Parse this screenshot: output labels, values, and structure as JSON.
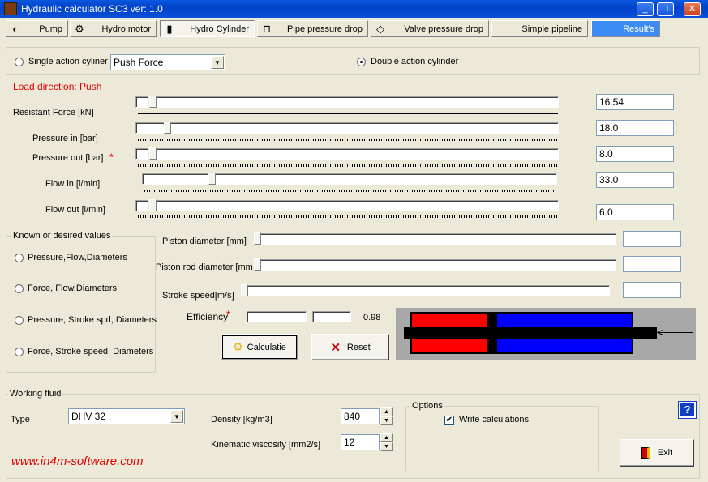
{
  "window": {
    "title": "Hydraulic calculator SC3  ver: 1.0",
    "min": "_",
    "max": "□",
    "close": "✕"
  },
  "toolbar": [
    {
      "label": "Pump",
      "icon": "◐"
    },
    {
      "label": "Hydro motor",
      "icon": "⚙"
    },
    {
      "label": "Hydro Cylinder",
      "icon": "▮"
    },
    {
      "label": "Pipe pressure drop",
      "icon": "⊓"
    },
    {
      "label": "Valve pressure drop",
      "icon": "◇"
    },
    {
      "label": "Simple pipeline",
      "icon": ""
    },
    {
      "label": "Result's",
      "icon": ""
    }
  ],
  "cylinder_type": {
    "single_label": "Single action cyliner",
    "force_select": "Push Force",
    "double_label": "Double action cylinder"
  },
  "load_direction": "Load direction: Push",
  "params": {
    "resistant_force": {
      "label": "Resistant Force [kN]",
      "value": "16.54"
    },
    "pressure_in": {
      "label": "Pressure in [bar]",
      "value": "18.0"
    },
    "pressure_out": {
      "label": "Pressure out [bar]",
      "star": "*",
      "value": "8.0"
    },
    "flow_in": {
      "label": "Flow in [l/min]",
      "value": "33.0"
    },
    "flow_out": {
      "label": "Flow out [l/min]",
      "value": "6.0"
    }
  },
  "known_values": {
    "title": "Known or desired values",
    "options": [
      "Pressure,Flow,Diameters",
      "Force, Flow,Diameters",
      "Pressure, Stroke spd, Diameters",
      "Force, Stroke speed, Diameters"
    ]
  },
  "geometry": {
    "piston_diameter": "Piston diameter [mm]",
    "rod_diameter": "Piston rod diameter [mm",
    "stroke_speed": "Stroke speed[m/s]",
    "efficiency_label": "Efficiency",
    "efficiency_star": "*",
    "efficiency_value": "0.98"
  },
  "actions": {
    "calculate": "Calculatie",
    "reset": "Reset"
  },
  "working_fluid": {
    "title": "Working fluid",
    "type_label": "Type",
    "type_value": "DHV 32",
    "density_label": "Density [kg/m3]",
    "density_value": "840",
    "viscosity_label": "Kinematic viscosity [mm2/s]",
    "viscosity_value": "12"
  },
  "options": {
    "title": "Options",
    "write_calc": "Write calculations",
    "checked": true
  },
  "help": "?",
  "exit": "Exit",
  "website": "www.in4m-software.com",
  "colors": {
    "red": "#ff0000",
    "blue": "#0000ff",
    "accent": "#3c8cf4",
    "website": "#e00000"
  }
}
